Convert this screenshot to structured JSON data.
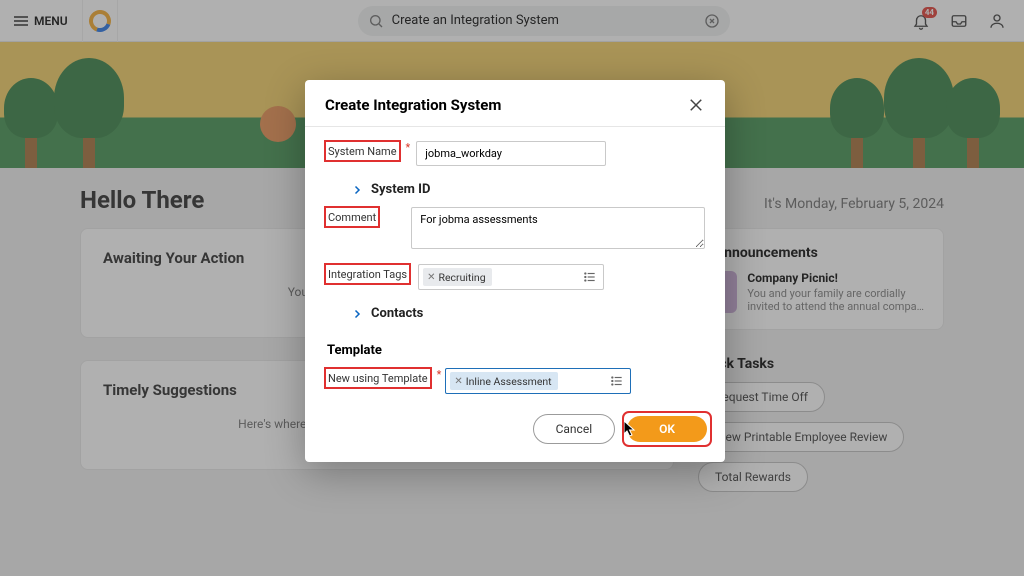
{
  "header": {
    "menu_label": "MENU",
    "search_value": "Create an Integration System",
    "badge": "44"
  },
  "page": {
    "title": "Hello There",
    "date": "It's Monday, February 5, 2024",
    "cards": {
      "awaiting": {
        "title": "Awaiting Your Action",
        "body": "You're all caught up on your inbox"
      },
      "timely": {
        "title": "Timely Suggestions",
        "body": "Here's where you'll get updates on your active items."
      }
    },
    "side": {
      "announcements_title": "Announcements",
      "ann_title": "Company Picnic!",
      "ann_body": "You and your family are cordially invited to attend the annual compa…",
      "quicktasks_title": "Quick Tasks",
      "chips": [
        "Request Time Off",
        "View Printable Employee Review",
        "Total Rewards"
      ]
    }
  },
  "modal": {
    "title": "Create Integration System",
    "labels": {
      "system_name": "System Name",
      "system_id": "System ID",
      "comment": "Comment",
      "integration_tags": "Integration Tags",
      "contacts": "Contacts",
      "template_section": "Template",
      "new_using_template": "New using Template"
    },
    "values": {
      "system_name": "jobma_workday",
      "comment": "For jobma assessments",
      "tag": "Recruiting",
      "template": "Inline Assessment"
    },
    "buttons": {
      "cancel": "Cancel",
      "ok": "OK"
    }
  }
}
